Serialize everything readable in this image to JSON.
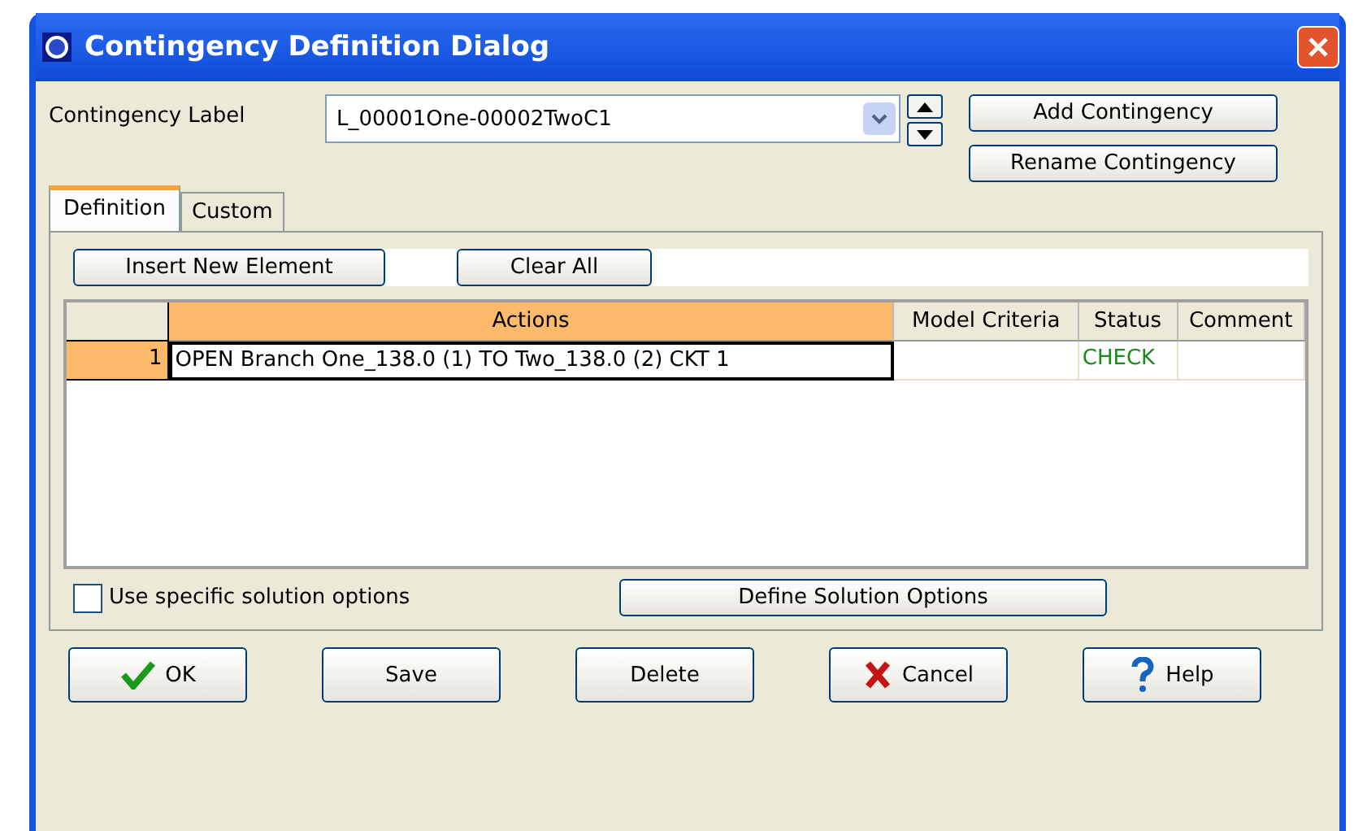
{
  "window": {
    "title": "Contingency Definition Dialog"
  },
  "contingency_label": {
    "label": "Contingency Label",
    "value": "L_00001One-00002TwoC1"
  },
  "top_buttons": [
    "Add Contingency",
    "Rename Contingency"
  ],
  "tabs": [
    {
      "label": "Definition",
      "selected": true
    },
    {
      "label": "Custom",
      "selected": false
    }
  ],
  "toolbar_buttons": [
    "Insert New Element",
    "Clear All"
  ],
  "table": {
    "columns": [
      "Actions",
      "Model Criteria",
      "Status",
      "Comment"
    ],
    "rows": [
      {
        "number": "1",
        "actions": "OPEN Branch One_138.0 (1)  TO  Two_138.0 (2) CKT 1",
        "model_criteria": "",
        "status": "CHECK",
        "selected": true
      }
    ]
  },
  "solution_options": {
    "label": "Use specific solution options",
    "checked": false,
    "button": "Define Solution Options"
  },
  "bottom_buttons": [
    {
      "label": "OK",
      "kind": "ok"
    },
    {
      "label": "Save",
      "kind": "plain"
    },
    {
      "label": "Delete",
      "kind": "plain"
    },
    {
      "label": "Cancel",
      "kind": "cancel"
    },
    {
      "label": "Help",
      "kind": "help"
    }
  ]
}
